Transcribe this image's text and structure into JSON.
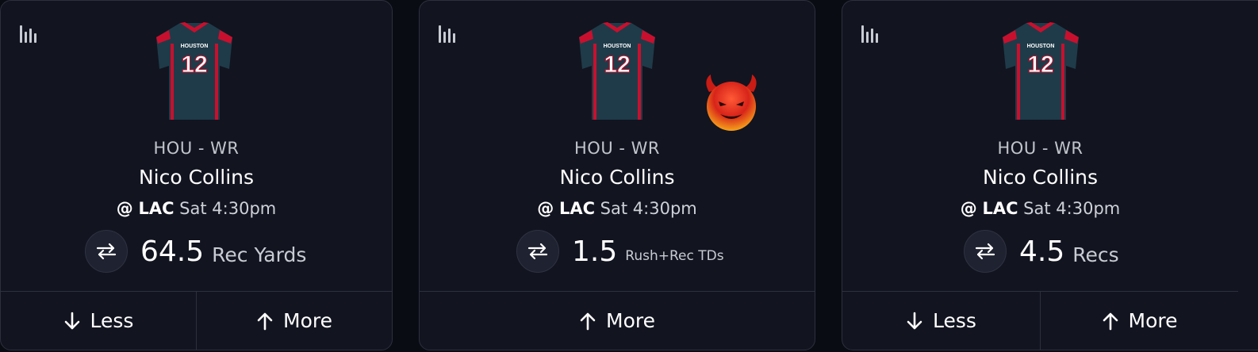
{
  "cards": [
    {
      "jersey_team": "HOUSTON",
      "jersey_number": "12",
      "position": "HOU - WR",
      "player": "Nico Collins",
      "at": "@",
      "opponent": "LAC",
      "time": "Sat 4:30pm",
      "line": "64.5",
      "stat": "Rec Yards",
      "less_label": "Less",
      "more_label": "More"
    },
    {
      "jersey_team": "HOUSTON",
      "jersey_number": "12",
      "position": "HOU - WR",
      "player": "Nico Collins",
      "at": "@",
      "opponent": "LAC",
      "time": "Sat 4:30pm",
      "line": "1.5",
      "stat": "Rush+Rec TDs",
      "more_label": "More"
    },
    {
      "jersey_team": "HOUSTON",
      "jersey_number": "12",
      "position": "HOU - WR",
      "player": "Nico Collins",
      "at": "@",
      "opponent": "LAC",
      "time": "Sat 4:30pm",
      "line": "4.5",
      "stat": "Recs",
      "less_label": "Less",
      "more_label": "More"
    }
  ],
  "icons": {
    "stats": "bar-chart-icon",
    "swap": "swap-arrows-icon",
    "less": "arrow-down-icon",
    "more": "arrow-up-icon",
    "badge": "devil-emoji-icon"
  },
  "colors": {
    "background": "#0a0c13",
    "card": "#121420",
    "border": "#2d303d",
    "jersey_body": "#1f3b49",
    "jersey_trim": "#c8102e"
  }
}
